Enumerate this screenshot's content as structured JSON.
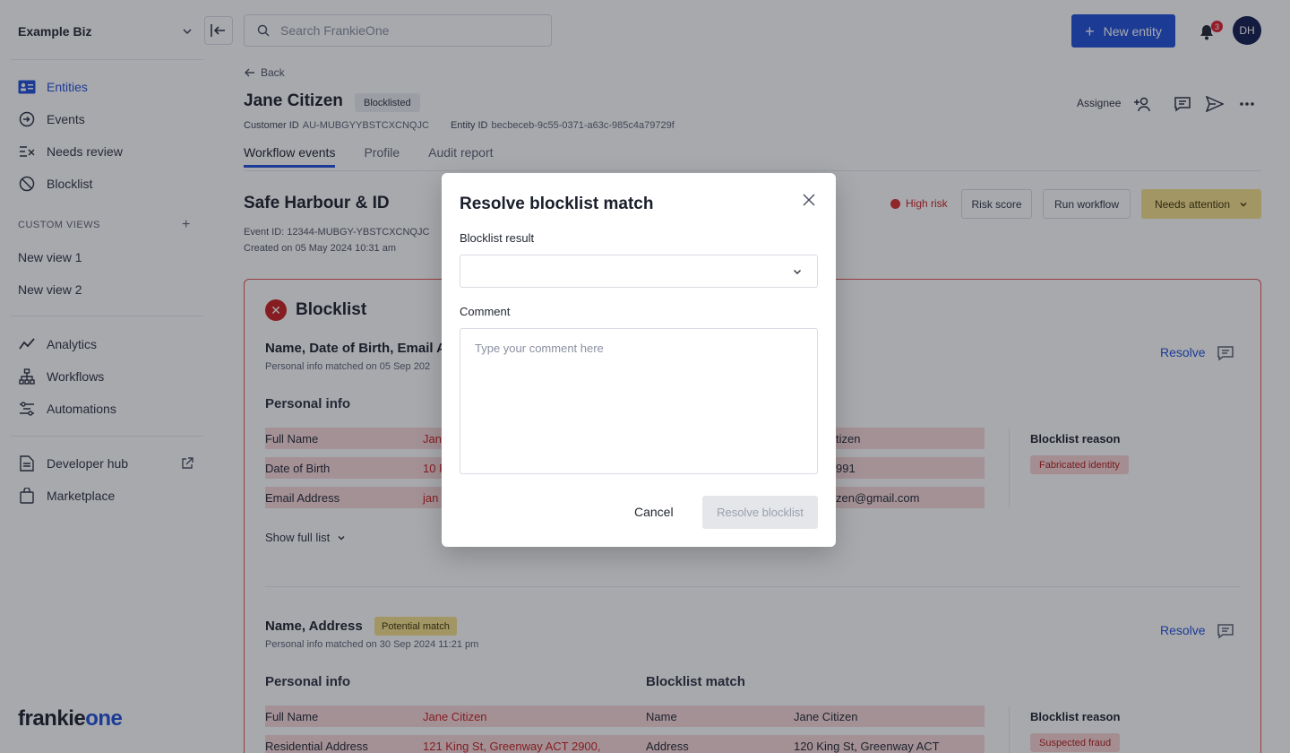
{
  "sidebar": {
    "org_name": "Example Biz",
    "nav": [
      {
        "label": "Entities",
        "icon": "id-card-icon",
        "active": true
      },
      {
        "label": "Events",
        "icon": "events-icon"
      },
      {
        "label": "Needs review",
        "icon": "needs-review-icon"
      },
      {
        "label": "Blocklist",
        "icon": "blocklist-icon"
      }
    ],
    "custom_views_label": "CUSTOM VIEWS",
    "custom_views": [
      "New view 1",
      "New view 2"
    ],
    "tools": [
      {
        "label": "Analytics",
        "icon": "analytics-icon"
      },
      {
        "label": "Workflows",
        "icon": "workflows-icon"
      },
      {
        "label": "Automations",
        "icon": "automations-icon"
      }
    ],
    "bottom": [
      {
        "label": "Developer hub",
        "icon": "document-icon"
      },
      {
        "label": "Marketplace",
        "icon": "bag-icon"
      }
    ],
    "logo_dark": "frankie",
    "logo_accent": "one"
  },
  "topbar": {
    "search_placeholder": "Search FrankieOne",
    "new_entity_label": "New entity",
    "notification_count": "3",
    "avatar_initials": "DH"
  },
  "entity": {
    "back_label": "Back",
    "name": "Jane Citizen",
    "status": "Blocklisted",
    "customer_id_label": "Customer ID",
    "customer_id": "AU-MUBGYYBSTCXCNQJC",
    "entity_id_label": "Entity ID",
    "entity_id": "becbeceb-9c55-0371-a63c-985c4a79729f",
    "assignee_label": "Assignee",
    "tabs": [
      "Workflow events",
      "Profile",
      "Audit report"
    ]
  },
  "workflow": {
    "title": "Safe Harbour & ID",
    "event_id": "Event ID: 12344-MUBGY-YBSTCXCNQJC",
    "created": "Created on 05 May 2024 10:31 am",
    "risk_label": "High risk",
    "risk_score_label": "Risk score",
    "run_workflow_label": "Run workflow",
    "status_label": "Needs attention"
  },
  "blocklist_card": {
    "title": "Blocklist",
    "matches": [
      {
        "title": "Name, Date of Birth, Email A",
        "subtitle": "Personal info matched on 05 Sep 202",
        "resolve_label": "Resolve",
        "personal_info_label": "Personal info",
        "rows": [
          {
            "label": "Full Name",
            "value": "Jan",
            "match": "tizen"
          },
          {
            "label": "Date of Birth",
            "value": "10 F",
            "match": "991"
          },
          {
            "label": "Email Address",
            "value": "jan",
            "match": "zen@gmail.com"
          }
        ],
        "reason_label": "Blocklist reason",
        "reason": "Fabricated identity",
        "show_full_label": "Show full list"
      },
      {
        "title": "Name, Address",
        "badge": "Potential match",
        "subtitle": "Personal info matched on 30 Sep 2024 11:21 pm",
        "resolve_label": "Resolve",
        "personal_info_label": "Personal info",
        "blocklist_match_label": "Blocklist match",
        "rows": [
          {
            "label": "Full Name",
            "value": "Jane Citizen",
            "match_label": "Name",
            "match": "Jane Citizen"
          },
          {
            "label": "Residential Address",
            "value": "121 King St, Greenway ACT 2900,",
            "match_label": "Address",
            "match": "120 King St, Greenway ACT"
          }
        ],
        "reason_label": "Blocklist reason",
        "reason": "Suspected fraud"
      }
    ]
  },
  "modal": {
    "title": "Resolve blocklist match",
    "result_label": "Blocklist result",
    "result_value": "",
    "comment_label": "Comment",
    "comment_placeholder": "Type your comment here",
    "cancel_label": "Cancel",
    "submit_label": "Resolve blocklist"
  },
  "colors": {
    "primary": "#1d4ed8",
    "danger": "#c81e1e",
    "warning": "#f5e08a"
  }
}
